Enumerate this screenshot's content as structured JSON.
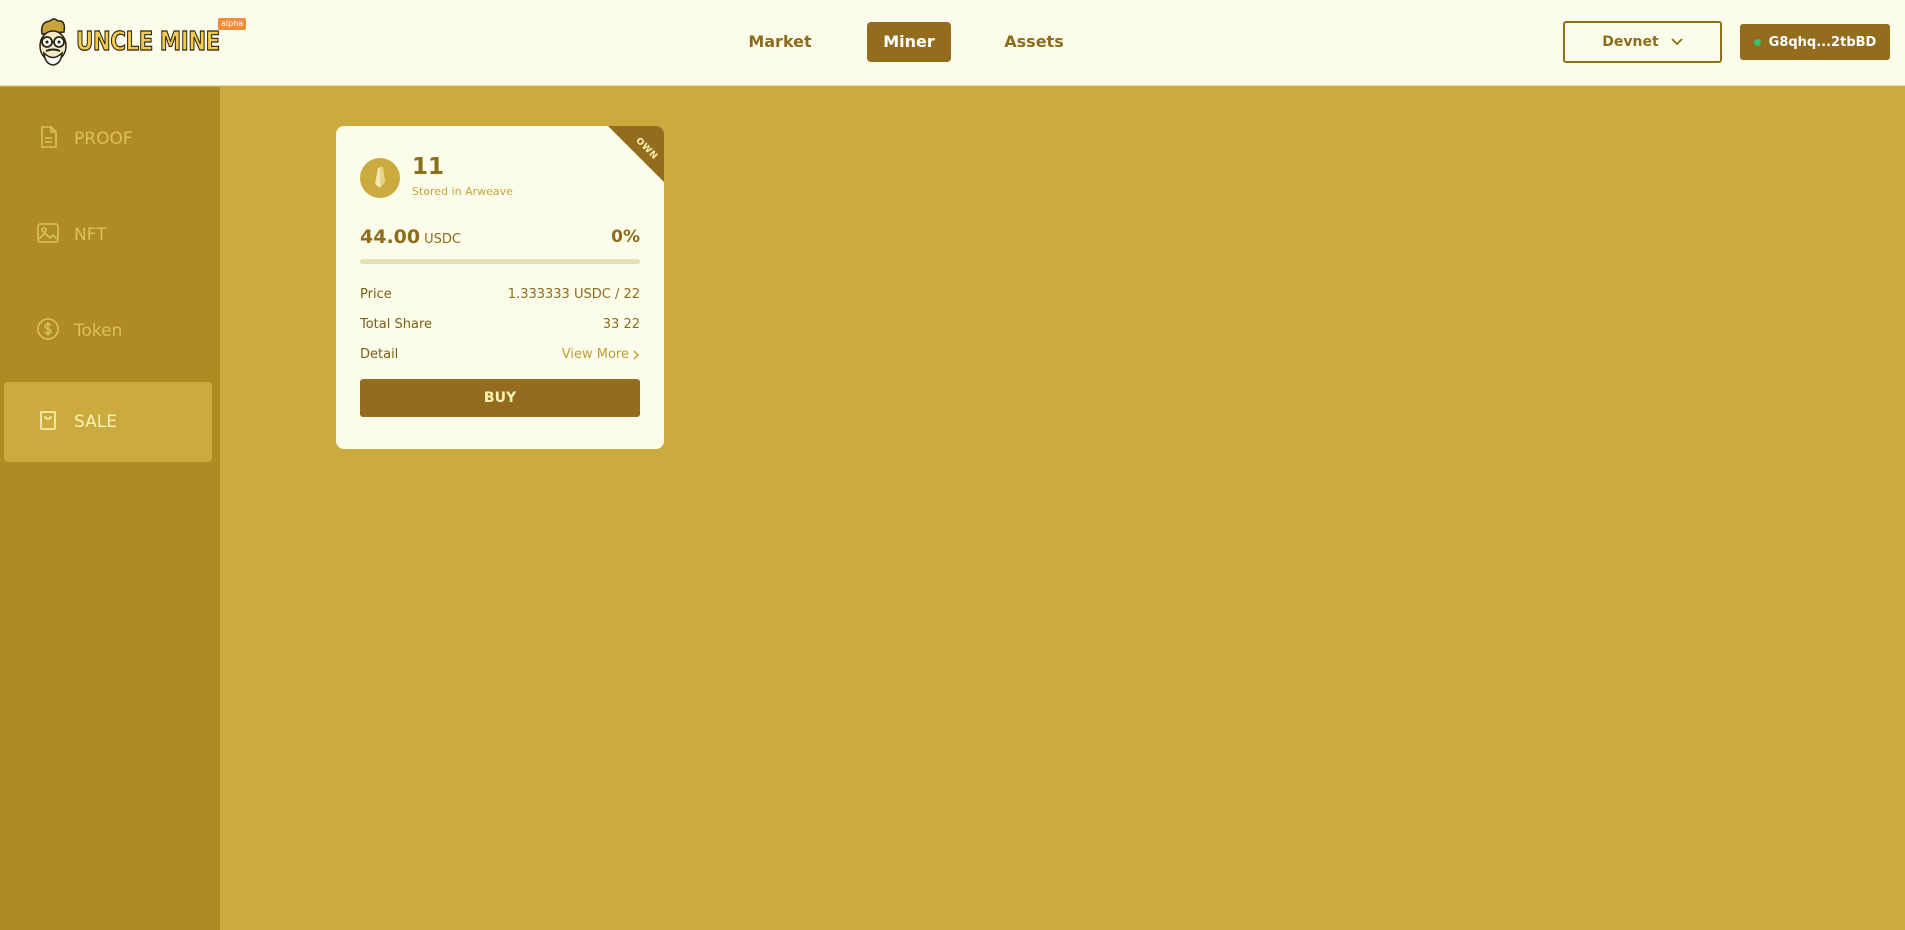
{
  "header": {
    "logo_text": "UNCLE MINE",
    "logo_badge": "alpha",
    "nav": [
      {
        "label": "Market"
      },
      {
        "label": "Miner",
        "active": true
      },
      {
        "label": "Assets"
      }
    ],
    "network": {
      "label": "Devnet",
      "icon": "chevron-down-icon"
    },
    "wallet": {
      "label": "G8qhq...2tbBD",
      "status_color": "#38c26a"
    }
  },
  "sidebar": {
    "items": [
      {
        "label": "PROOF",
        "icon": "document-icon"
      },
      {
        "label": "NFT",
        "icon": "image-icon"
      },
      {
        "label": "Token",
        "icon": "dollar-coin-icon"
      },
      {
        "label": "SALE",
        "icon": "shopping-bag-icon",
        "active": true
      }
    ]
  },
  "card": {
    "ribbon": "OWN",
    "id": "11",
    "subtitle": "Stored in Arweave",
    "amount": "44.00",
    "currency": "USDC",
    "percent": "0%",
    "progress": 0,
    "rows": {
      "price_label": "Price",
      "price_value": "1.333333 USDC / 22",
      "share_label": "Total Share",
      "share_value": "33 22",
      "detail_label": "Detail",
      "detail_value": "View More"
    },
    "buy_label": "BUY"
  },
  "colors": {
    "background": "#cbaa3e",
    "header_bg": "#fbfdea",
    "sidebar_bg": "#b08b23",
    "accent": "#936d1d"
  }
}
